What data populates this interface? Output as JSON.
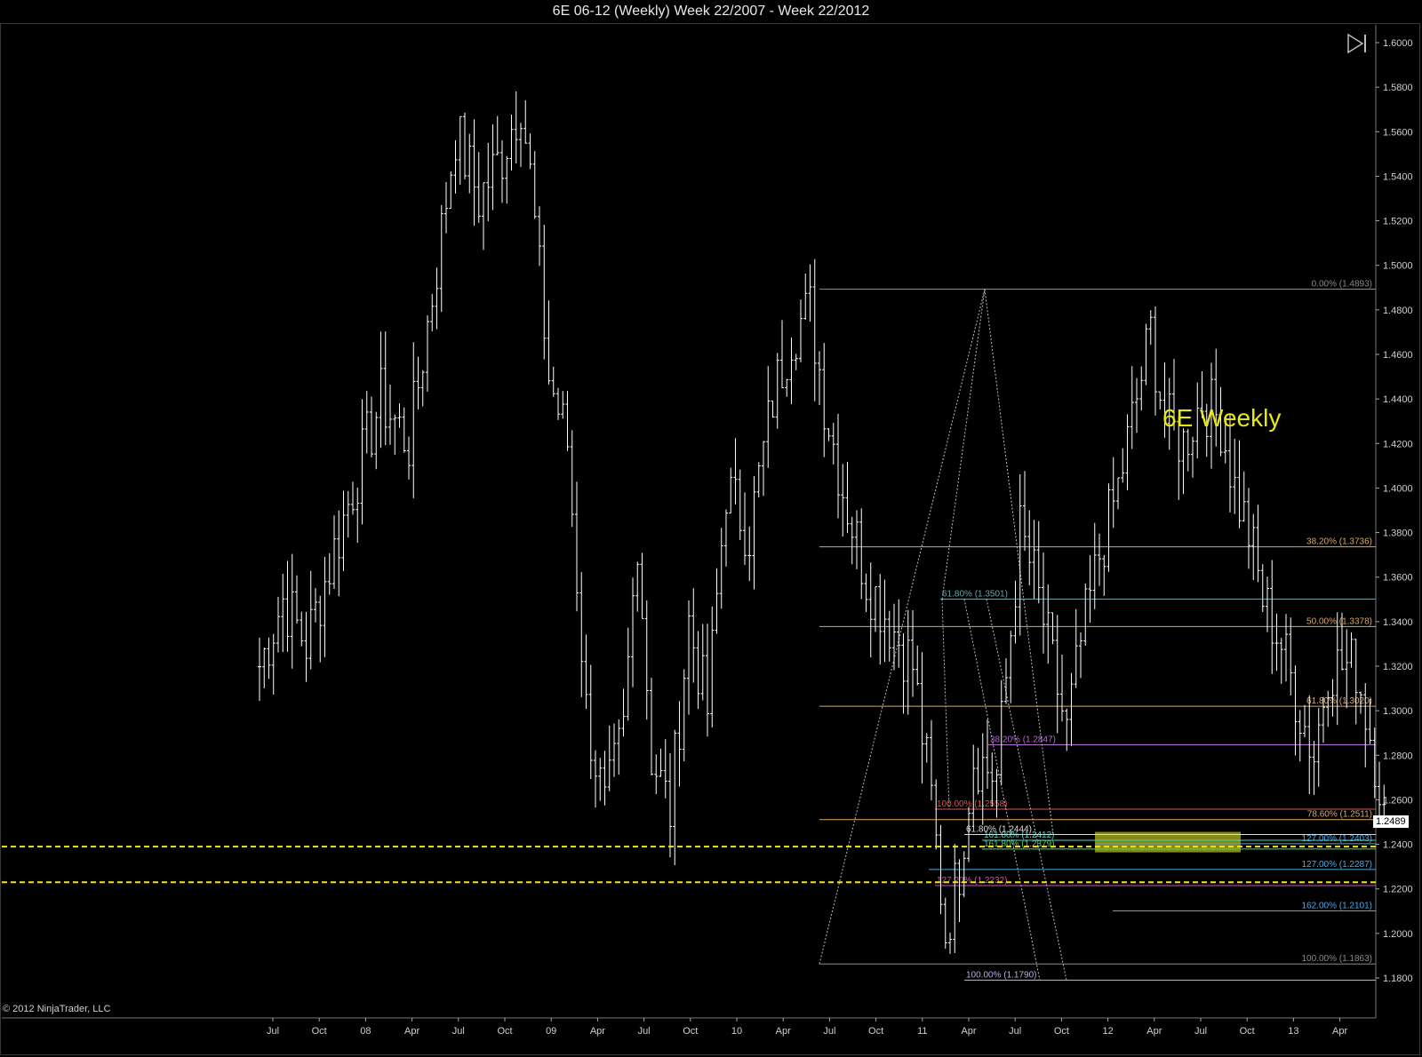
{
  "title": "6E 06-12 (Weekly)  Week 22/2007 - Week 22/2012",
  "watermark": "6E Weekly",
  "copyright": "© 2012 NinjaTrader, LLC",
  "last_price": "1.2489",
  "icons": {
    "nav": "skip-forward-icon"
  },
  "colors": {
    "background": "#000000",
    "bars": "#ffffff",
    "support": "#f5e50a",
    "watermark": "#e6e619",
    "zone": "#9aa21a"
  },
  "chart_data": {
    "type": "ohlc-bar",
    "ylim": [
      1.16,
      1.61
    ],
    "yticks": [
      "1.6000",
      "1.5800",
      "1.5600",
      "1.5400",
      "1.5200",
      "1.5000",
      "1.4800",
      "1.4600",
      "1.4400",
      "1.4200",
      "1.4000",
      "1.3800",
      "1.3600",
      "1.3400",
      "1.3200",
      "1.3000",
      "1.2800",
      "1.2600",
      "1.2400",
      "1.2200",
      "1.2000",
      "1.1800"
    ],
    "xticks": [
      "Jul",
      "Oct",
      "08",
      "Apr",
      "Jul",
      "Oct",
      "09",
      "Apr",
      "Jul",
      "Oct",
      "10",
      "Apr",
      "Jul",
      "Oct",
      "11",
      "Apr",
      "Jul",
      "Oct",
      "12",
      "Apr",
      "Jul",
      "Oct",
      "13",
      "Apr"
    ],
    "anchors": [
      {
        "week": 0,
        "close": 1.32
      },
      {
        "week": 5,
        "close": 1.35
      },
      {
        "week": 10,
        "close": 1.33
      },
      {
        "week": 20,
        "close": 1.4
      },
      {
        "week": 26,
        "close": 1.44
      },
      {
        "week": 32,
        "close": 1.42
      },
      {
        "week": 38,
        "close": 1.5
      },
      {
        "week": 42,
        "close": 1.56
      },
      {
        "week": 47,
        "close": 1.53
      },
      {
        "week": 52,
        "close": 1.55
      },
      {
        "week": 56,
        "close": 1.575
      },
      {
        "week": 58,
        "close": 1.54
      },
      {
        "week": 62,
        "close": 1.45
      },
      {
        "week": 66,
        "close": 1.42
      },
      {
        "week": 70,
        "close": 1.3
      },
      {
        "week": 74,
        "close": 1.255
      },
      {
        "week": 78,
        "close": 1.29
      },
      {
        "week": 81,
        "close": 1.38
      },
      {
        "week": 84,
        "close": 1.28
      },
      {
        "week": 88,
        "close": 1.255
      },
      {
        "week": 92,
        "close": 1.34
      },
      {
        "week": 96,
        "close": 1.3
      },
      {
        "week": 100,
        "close": 1.4
      },
      {
        "week": 105,
        "close": 1.38
      },
      {
        "week": 110,
        "close": 1.44
      },
      {
        "week": 114,
        "close": 1.47
      },
      {
        "week": 118,
        "close": 1.48
      },
      {
        "week": 121,
        "close": 1.44
      },
      {
        "week": 125,
        "close": 1.4
      },
      {
        "week": 130,
        "close": 1.36
      },
      {
        "week": 135,
        "close": 1.34
      },
      {
        "week": 140,
        "close": 1.32
      },
      {
        "week": 144,
        "close": 1.26
      },
      {
        "week": 147,
        "close": 1.2
      },
      {
        "week": 150,
        "close": 1.23
      },
      {
        "week": 153,
        "close": 1.28
      },
      {
        "week": 158,
        "close": 1.27
      },
      {
        "week": 163,
        "close": 1.38
      },
      {
        "week": 166,
        "close": 1.36
      },
      {
        "week": 170,
        "close": 1.32
      },
      {
        "week": 173,
        "close": 1.29
      },
      {
        "week": 176,
        "close": 1.33
      },
      {
        "week": 180,
        "close": 1.37
      },
      {
        "week": 184,
        "close": 1.4
      },
      {
        "week": 188,
        "close": 1.44
      },
      {
        "week": 191,
        "close": 1.47
      },
      {
        "week": 194,
        "close": 1.43
      },
      {
        "week": 198,
        "close": 1.42
      },
      {
        "week": 202,
        "close": 1.44
      },
      {
        "week": 206,
        "close": 1.43
      },
      {
        "week": 209,
        "close": 1.4
      },
      {
        "week": 212,
        "close": 1.38
      },
      {
        "week": 215,
        "close": 1.35
      },
      {
        "week": 219,
        "close": 1.33
      },
      {
        "week": 223,
        "close": 1.3
      },
      {
        "week": 226,
        "close": 1.28
      },
      {
        "week": 229,
        "close": 1.32
      },
      {
        "week": 232,
        "close": 1.32
      },
      {
        "week": 235,
        "close": 1.32
      },
      {
        "week": 237,
        "close": 1.3
      },
      {
        "week": 239,
        "close": 1.28
      },
      {
        "week": 241,
        "close": 1.258
      }
    ],
    "support_lines": [
      1.239,
      1.223
    ],
    "fib_levels": [
      {
        "label": "0.00% (1.4893)",
        "value": 1.4893,
        "color": "#8a8a8a",
        "x0": 922,
        "x1": 1548,
        "labelSide": "right"
      },
      {
        "label": "38.20% (1.3736)",
        "value": 1.3736,
        "color": "#d9a865",
        "x0": 922,
        "x1": 1548,
        "labelSide": "right"
      },
      {
        "label": "50.00% (1.3378)",
        "value": 1.3378,
        "color": "#d9a865",
        "x0": 922,
        "x1": 1548,
        "labelSide": "right"
      },
      {
        "label": "61.80% (1.3020)",
        "value": 1.302,
        "color": "#d9a865",
        "x0": 922,
        "x1": 1548,
        "labelSide": "right"
      },
      {
        "label": "78.60% (1.2511)",
        "value": 1.2511,
        "color": "#d9a865",
        "x0": 922,
        "x1": 1548,
        "labelSide": "right"
      },
      {
        "label": "100.00% (1.1863)",
        "value": 1.1863,
        "color": "#8a8a8a",
        "x0": 922,
        "x1": 1548,
        "labelSide": "right"
      },
      {
        "label": "38.20% (1.2847)",
        "value": 1.2847,
        "color": "#b36bd1",
        "x0": 1112,
        "x1": 1548,
        "labelSide": "left"
      },
      {
        "label": "100.00% (1.2558)",
        "value": 1.2558,
        "color": "#d9534f",
        "x0": 1052,
        "x1": 1548,
        "labelSide": "left"
      },
      {
        "label": "127.00% (1.2403)",
        "value": 1.2403,
        "color": "#4aa8e6",
        "x0": 1232,
        "x1": 1548,
        "labelSide": "right"
      },
      {
        "label": "127.00% (1.2287)",
        "value": 1.2287,
        "color": "#4aa8e6",
        "x0": 1045,
        "x1": 1548,
        "labelSide": "right"
      },
      {
        "label": "162.00% (1.2101)",
        "value": 1.2101,
        "color": "#4aa8e6",
        "x0": 1252,
        "x1": 1548,
        "labelSide": "right"
      },
      {
        "label": "127.20% (1.2232)",
        "value": 1.2215,
        "color": "#d44fb7",
        "x0": 1052,
        "x1": 1548,
        "labelSide": "left"
      },
      {
        "label": "161.80% (1.2379)",
        "value": 1.2379,
        "color": "#55d06a",
        "x0": 1105,
        "x1": 1548,
        "labelSide": "left"
      },
      {
        "label": "161.80% (1.2412)",
        "value": 1.2418,
        "color": "#55d0c0",
        "x0": 1105,
        "x1": 1548,
        "labelSide": "left"
      },
      {
        "label": "61.80% (1.2444)",
        "value": 1.2444,
        "color": "#dddddd",
        "x0": 1085,
        "x1": 1548,
        "labelSide": "left"
      },
      {
        "label": "61.80% (1.3501)",
        "value": 1.3501,
        "color": "#6aa3a3",
        "x0": 1058,
        "x1": 1548,
        "labelSide": "left"
      },
      {
        "label": "100.00% (1.1790)",
        "value": 1.179,
        "color": "#b0b0e0",
        "x0": 1085,
        "x1": 1548,
        "labelSide": "left"
      }
    ],
    "zone": {
      "from": 1.238,
      "to": 1.244
    }
  }
}
